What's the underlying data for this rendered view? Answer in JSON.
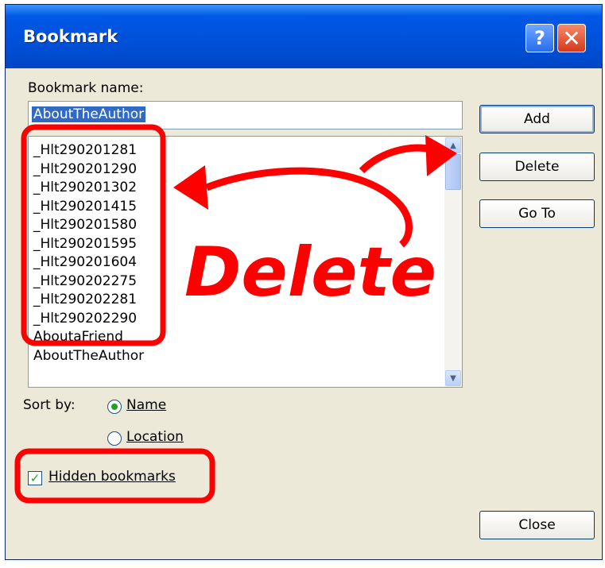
{
  "dialog": {
    "title": "Bookmark",
    "help_glyph": "?",
    "close_glyph": "✕"
  },
  "bookmark_name": {
    "label": "Bookmark name:",
    "value": "AboutTheAuthor"
  },
  "bookmarks": [
    "_Hlt290201281",
    "_Hlt290201290",
    "_Hlt290201302",
    "_Hlt290201415",
    "_Hlt290201580",
    "_Hlt290201595",
    "_Hlt290201604",
    "_Hlt290202275",
    "_Hlt290202281",
    "_Hlt290202290",
    "AboutaFriend",
    "AboutTheAuthor"
  ],
  "buttons": {
    "add": "Add",
    "delete": "Delete",
    "goto": "Go To",
    "close": "Close"
  },
  "sort": {
    "label": "Sort by:",
    "options": [
      "Name",
      "Location"
    ],
    "selected": "Name"
  },
  "hidden_bookmarks": {
    "label": "Hidden bookmarks",
    "checked": true
  },
  "annotation": {
    "text": "Delete",
    "color": "#ff0000"
  },
  "colors": {
    "title_bar": "#0058e6",
    "dialog_bg": "#ece9d8",
    "selection": "#316ac5"
  }
}
